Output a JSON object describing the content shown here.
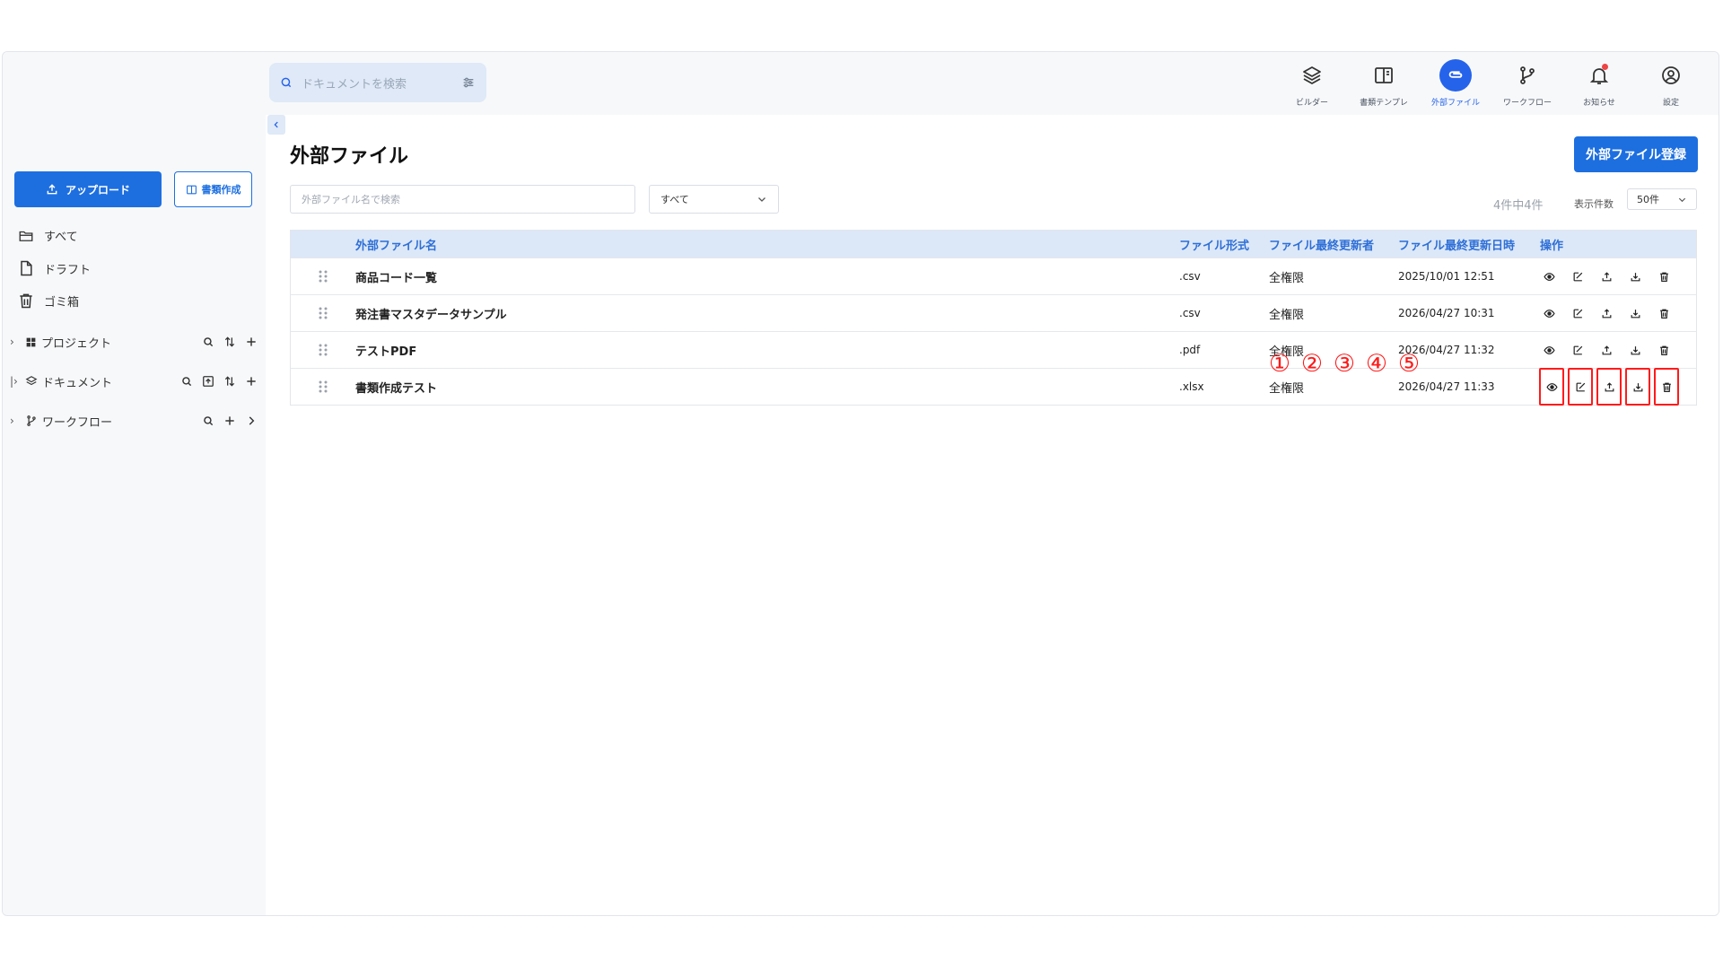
{
  "header": {
    "search_placeholder": "ドキュメントを検索",
    "nav": [
      {
        "label": "ビルダー",
        "icon": "layers-icon"
      },
      {
        "label": "書類テンプレ",
        "icon": "book-icon"
      },
      {
        "label": "外部ファイル",
        "icon": "paperclip-icon",
        "active": true
      },
      {
        "label": "ワークフロー",
        "icon": "git-branch-icon"
      },
      {
        "label": "お知らせ",
        "icon": "bell-icon"
      },
      {
        "label": "設定",
        "icon": "user-circle-icon"
      }
    ]
  },
  "sidebar": {
    "upload_label": "アップロード",
    "create_doc_label": "書類作成",
    "links": [
      {
        "label": "すべて",
        "icon": "folder-icon"
      },
      {
        "label": "ドラフト",
        "icon": "file-icon"
      },
      {
        "label": "ゴミ箱",
        "icon": "trash-icon"
      }
    ],
    "tree": [
      {
        "label": "プロジェクト",
        "icon": "grid-icon"
      },
      {
        "label": "ドキュメント",
        "icon": "layers-icon"
      },
      {
        "label": "ワークフロー",
        "icon": "git-branch-icon"
      }
    ]
  },
  "main": {
    "title": "外部ファイル",
    "register_label": "外部ファイル登録",
    "filter_placeholder": "外部ファイル名で検索",
    "filter_select": "すべて",
    "count_text": "4件中4件",
    "per_page_label": "表示件数",
    "per_page_value": "50件",
    "columns": [
      "外部ファイル名",
      "ファイル形式",
      "ファイル最終更新者",
      "ファイル最終更新日時",
      "操作"
    ],
    "rows": [
      {
        "name": "商品コード一覧",
        "format": ".csv",
        "updater": "全権限",
        "date": "2025/10/01 12:51"
      },
      {
        "name": "発注書マスタデータサンプル",
        "format": ".csv",
        "updater": "全権限",
        "date": "2026/04/27 10:31"
      },
      {
        "name": "テストPDF",
        "format": ".pdf",
        "updater": "全権限",
        "date": "2026/04/27 11:32"
      },
      {
        "name": "書類作成テスト",
        "format": ".xlsx",
        "updater": "全権限",
        "date": "2026/04/27 11:33"
      }
    ],
    "operation_icons": [
      "eye-icon",
      "edit-icon",
      "upload-icon",
      "download-icon",
      "trash-icon"
    ]
  },
  "annotations": {
    "markers": [
      "①",
      "②",
      "③",
      "④",
      "⑤"
    ],
    "color": "#ff1a1a"
  },
  "colors": {
    "accent": "#1d6fe0",
    "header_row": "#dce8f8"
  }
}
